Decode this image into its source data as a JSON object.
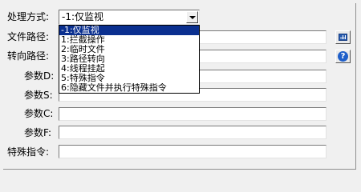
{
  "form": {
    "mode_label": "处理方式:",
    "mode_value": "-1:仅监视",
    "file_path_label": "文件路径:",
    "file_path_value": "",
    "redirect_path_label": "转向路径:",
    "redirect_path_value": "",
    "param_d_label": "参数D:",
    "param_s_label": "参数S:",
    "param_c_label": "参数C:",
    "param_f_label": "参数F:",
    "special_cmd_label": "特殊指令:"
  },
  "dropdown": {
    "options": [
      "-1:仅监视",
      "1:拦截操作",
      "2:临时文件",
      "3:路径转向",
      "4:线程挂起",
      "5:特殊指令",
      "6:隐藏文件并执行特殊指令"
    ],
    "selected_index": 0
  },
  "icons": {
    "browse": "grid-icon",
    "help": "help-icon"
  },
  "colors": {
    "selection": "#0a2f8f",
    "background": "#f0f0f0"
  }
}
